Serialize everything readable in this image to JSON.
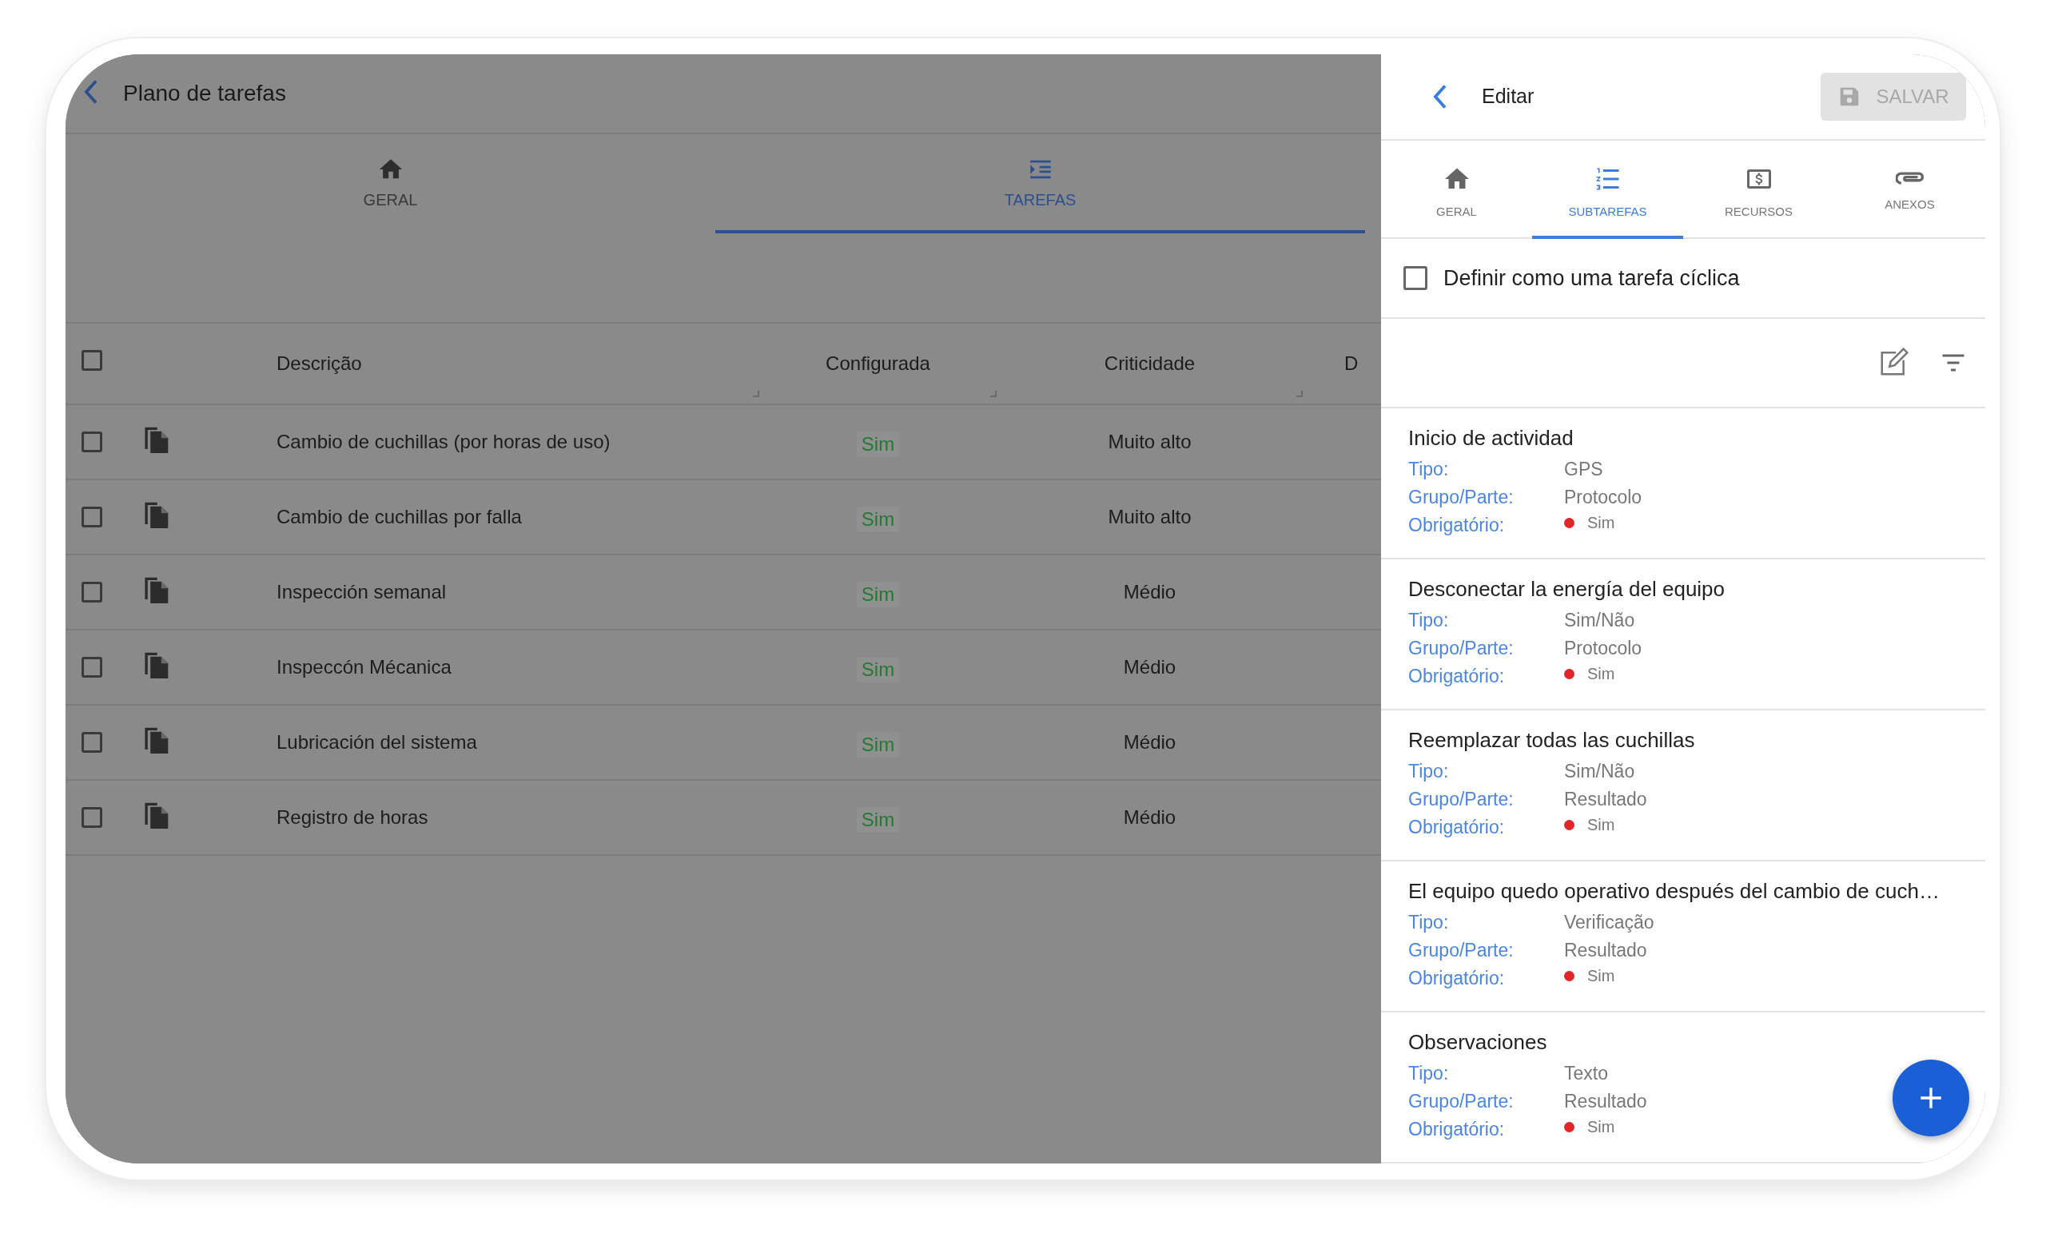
{
  "task_plan": {
    "title": "Plano de tarefas",
    "tabs": [
      {
        "label": "GERAL",
        "selected": false
      },
      {
        "label": "TAREFAS",
        "selected": true
      }
    ],
    "table": {
      "select_all": {
        "checked": false
      },
      "columns": [
        "Descrição",
        "Configurada",
        "Criticidade",
        "D"
      ],
      "rows": [
        {
          "checked": false,
          "description": "Cambio de cuchillas (por horas de uso)",
          "configured": "Sim",
          "criticality": "Muito alto"
        },
        {
          "checked": false,
          "description": "Cambio de cuchillas por falla",
          "configured": "Sim",
          "criticality": "Muito alto"
        },
        {
          "checked": false,
          "description": "Inspección semanal",
          "configured": "Sim",
          "criticality": "Médio"
        },
        {
          "checked": false,
          "description": "Inspeccón Mécanica",
          "configured": "Sim",
          "criticality": "Médio"
        },
        {
          "checked": false,
          "description": "Lubricación del sistema",
          "configured": "Sim",
          "criticality": "Médio"
        },
        {
          "checked": false,
          "description": "Registro de horas",
          "configured": "Sim",
          "criticality": "Médio"
        }
      ]
    }
  },
  "edit_panel": {
    "title": "Editar",
    "save_button": {
      "label": "SALVAR",
      "disabled": true
    },
    "tabs": [
      {
        "label": "GERAL",
        "selected": false
      },
      {
        "label": "SUBTAREFAS",
        "selected": true
      },
      {
        "label": "RECURSOS",
        "selected": false
      },
      {
        "label": "ANEXOS",
        "selected": false
      }
    ],
    "cyclic_task": {
      "label": "Definir como uma tarefa cíclica",
      "checked": false
    },
    "subtasks": [
      {
        "title": "Inicio de actividad",
        "fields": [
          {
            "kind": "text",
            "label": "Tipo:",
            "value": "GPS"
          },
          {
            "kind": "text",
            "label": "Grupo/Parte:",
            "value": "Protocolo"
          },
          {
            "kind": "flag",
            "label": "Obrigatório:",
            "value": "Sim"
          }
        ]
      },
      {
        "title": "Desconectar la energía del equipo",
        "fields": [
          {
            "kind": "text",
            "label": "Tipo:",
            "value": "Sim/Não"
          },
          {
            "kind": "text",
            "label": "Grupo/Parte:",
            "value": "Protocolo"
          },
          {
            "kind": "flag",
            "label": "Obrigatório:",
            "value": "Sim"
          }
        ]
      },
      {
        "title": "Reemplazar todas las cuchillas",
        "fields": [
          {
            "kind": "text",
            "label": "Tipo:",
            "value": "Sim/Não"
          },
          {
            "kind": "text",
            "label": "Grupo/Parte:",
            "value": "Resultado"
          },
          {
            "kind": "flag",
            "label": "Obrigatório:",
            "value": "Sim"
          }
        ]
      },
      {
        "title": "El equipo quedo operativo después del cambio de cuch…",
        "fields": [
          {
            "kind": "text",
            "label": "Tipo:",
            "value": "Verificação"
          },
          {
            "kind": "text",
            "label": "Grupo/Parte:",
            "value": "Resultado"
          },
          {
            "kind": "flag",
            "label": "Obrigatório:",
            "value": "Sim"
          }
        ]
      },
      {
        "title": "Observaciones",
        "fields": [
          {
            "kind": "text",
            "label": "Tipo:",
            "value": "Texto"
          },
          {
            "kind": "text",
            "label": "Grupo/Parte:",
            "value": "Resultado"
          },
          {
            "kind": "flag",
            "label": "Obrigatório:",
            "value": "Sim"
          }
        ]
      }
    ]
  }
}
